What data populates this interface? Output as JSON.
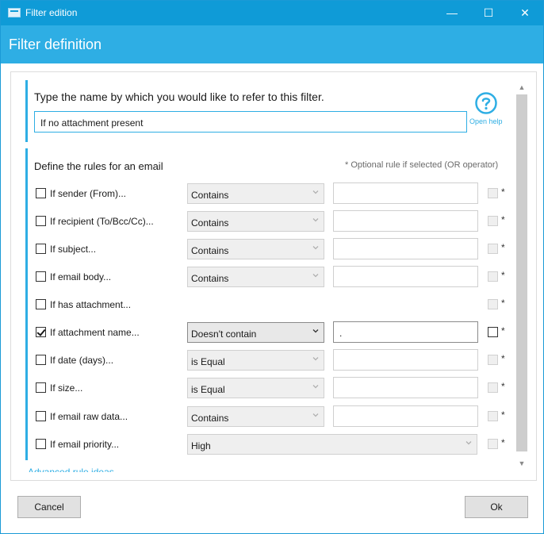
{
  "window": {
    "title": "Filter edition",
    "minimize_glyph": "—",
    "maximize_glyph": "☐",
    "close_glyph": "✕"
  },
  "header": {
    "title": "Filter definition"
  },
  "name_section": {
    "label": "Type the name by which you would like to refer to this filter.",
    "value": "If no attachment present",
    "help_label": "Open help",
    "help_icon": "question-circle-icon"
  },
  "rules_section": {
    "title": "Define the rules for an email",
    "optional_note": "* Optional rule if selected (OR operator)",
    "rules": [
      {
        "label": "If sender (From)...",
        "checked": false,
        "operator": "Contains",
        "value": "",
        "optional": false,
        "star": "*"
      },
      {
        "label": "If recipient (To/Bcc/Cc)...",
        "checked": false,
        "operator": "Contains",
        "value": "",
        "optional": false,
        "star": "*"
      },
      {
        "label": "If subject...",
        "checked": false,
        "operator": "Contains",
        "value": "",
        "optional": false,
        "star": "*"
      },
      {
        "label": "If email body...",
        "checked": false,
        "operator": "Contains",
        "value": "",
        "optional": false,
        "star": "*"
      },
      {
        "label": "If has attachment...",
        "checked": false,
        "star": "*"
      },
      {
        "label": "If attachment name...",
        "checked": true,
        "operator": "Doesn't contain",
        "value": ".",
        "optional": false,
        "star": "*"
      },
      {
        "label": "If date (days)...",
        "checked": false,
        "operator": "is Equal",
        "value": "",
        "optional": false,
        "star": "*"
      },
      {
        "label": "If size...",
        "checked": false,
        "operator": "is Equal",
        "value": "",
        "optional": false,
        "star": "*"
      },
      {
        "label": "If email raw data...",
        "checked": false,
        "operator": "Contains",
        "value": "",
        "optional": false,
        "star": "*"
      },
      {
        "label": "If email priority...",
        "checked": false,
        "operator": "High",
        "optional": false,
        "star": "*"
      }
    ],
    "advanced_link": "Advanced rule ideas..."
  },
  "buttons": {
    "cancel": "Cancel",
    "ok": "Ok"
  },
  "colors": {
    "accent": "#0f9bd7",
    "header": "#2eaee4"
  }
}
